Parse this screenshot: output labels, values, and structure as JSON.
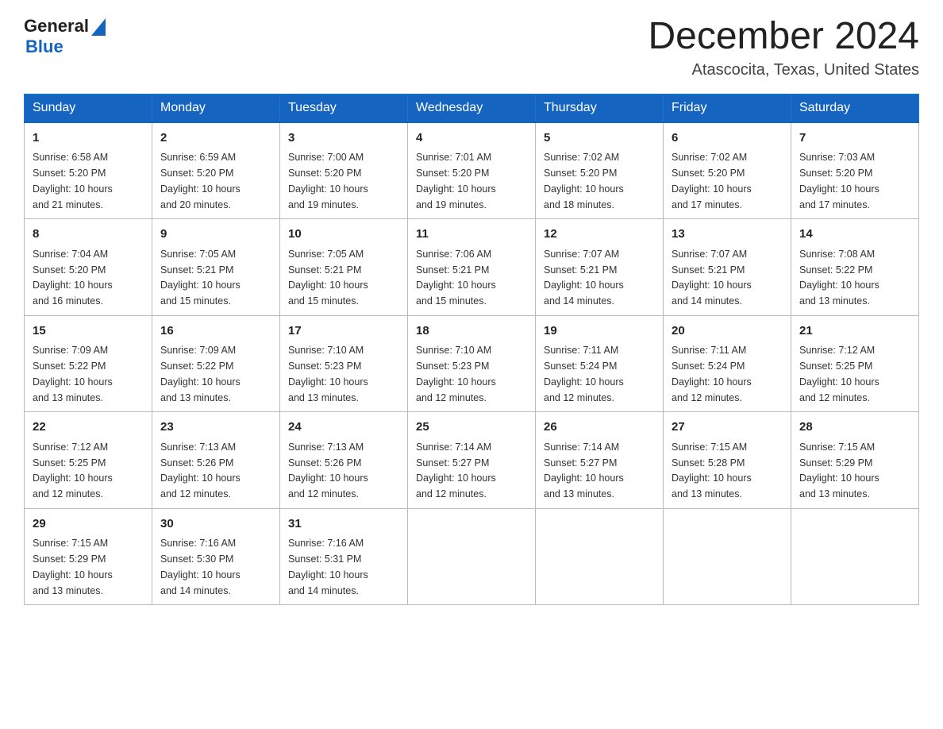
{
  "header": {
    "logo_text_general": "General",
    "logo_text_blue": "Blue",
    "month_title": "December 2024",
    "subtitle": "Atascocita, Texas, United States"
  },
  "days_of_week": [
    "Sunday",
    "Monday",
    "Tuesday",
    "Wednesday",
    "Thursday",
    "Friday",
    "Saturday"
  ],
  "weeks": [
    [
      {
        "day": "1",
        "sunrise": "6:58 AM",
        "sunset": "5:20 PM",
        "daylight": "10 hours and 21 minutes."
      },
      {
        "day": "2",
        "sunrise": "6:59 AM",
        "sunset": "5:20 PM",
        "daylight": "10 hours and 20 minutes."
      },
      {
        "day": "3",
        "sunrise": "7:00 AM",
        "sunset": "5:20 PM",
        "daylight": "10 hours and 19 minutes."
      },
      {
        "day": "4",
        "sunrise": "7:01 AM",
        "sunset": "5:20 PM",
        "daylight": "10 hours and 19 minutes."
      },
      {
        "day": "5",
        "sunrise": "7:02 AM",
        "sunset": "5:20 PM",
        "daylight": "10 hours and 18 minutes."
      },
      {
        "day": "6",
        "sunrise": "7:02 AM",
        "sunset": "5:20 PM",
        "daylight": "10 hours and 17 minutes."
      },
      {
        "day": "7",
        "sunrise": "7:03 AM",
        "sunset": "5:20 PM",
        "daylight": "10 hours and 17 minutes."
      }
    ],
    [
      {
        "day": "8",
        "sunrise": "7:04 AM",
        "sunset": "5:20 PM",
        "daylight": "10 hours and 16 minutes."
      },
      {
        "day": "9",
        "sunrise": "7:05 AM",
        "sunset": "5:21 PM",
        "daylight": "10 hours and 15 minutes."
      },
      {
        "day": "10",
        "sunrise": "7:05 AM",
        "sunset": "5:21 PM",
        "daylight": "10 hours and 15 minutes."
      },
      {
        "day": "11",
        "sunrise": "7:06 AM",
        "sunset": "5:21 PM",
        "daylight": "10 hours and 15 minutes."
      },
      {
        "day": "12",
        "sunrise": "7:07 AM",
        "sunset": "5:21 PM",
        "daylight": "10 hours and 14 minutes."
      },
      {
        "day": "13",
        "sunrise": "7:07 AM",
        "sunset": "5:21 PM",
        "daylight": "10 hours and 14 minutes."
      },
      {
        "day": "14",
        "sunrise": "7:08 AM",
        "sunset": "5:22 PM",
        "daylight": "10 hours and 13 minutes."
      }
    ],
    [
      {
        "day": "15",
        "sunrise": "7:09 AM",
        "sunset": "5:22 PM",
        "daylight": "10 hours and 13 minutes."
      },
      {
        "day": "16",
        "sunrise": "7:09 AM",
        "sunset": "5:22 PM",
        "daylight": "10 hours and 13 minutes."
      },
      {
        "day": "17",
        "sunrise": "7:10 AM",
        "sunset": "5:23 PM",
        "daylight": "10 hours and 13 minutes."
      },
      {
        "day": "18",
        "sunrise": "7:10 AM",
        "sunset": "5:23 PM",
        "daylight": "10 hours and 12 minutes."
      },
      {
        "day": "19",
        "sunrise": "7:11 AM",
        "sunset": "5:24 PM",
        "daylight": "10 hours and 12 minutes."
      },
      {
        "day": "20",
        "sunrise": "7:11 AM",
        "sunset": "5:24 PM",
        "daylight": "10 hours and 12 minutes."
      },
      {
        "day": "21",
        "sunrise": "7:12 AM",
        "sunset": "5:25 PM",
        "daylight": "10 hours and 12 minutes."
      }
    ],
    [
      {
        "day": "22",
        "sunrise": "7:12 AM",
        "sunset": "5:25 PM",
        "daylight": "10 hours and 12 minutes."
      },
      {
        "day": "23",
        "sunrise": "7:13 AM",
        "sunset": "5:26 PM",
        "daylight": "10 hours and 12 minutes."
      },
      {
        "day": "24",
        "sunrise": "7:13 AM",
        "sunset": "5:26 PM",
        "daylight": "10 hours and 12 minutes."
      },
      {
        "day": "25",
        "sunrise": "7:14 AM",
        "sunset": "5:27 PM",
        "daylight": "10 hours and 12 minutes."
      },
      {
        "day": "26",
        "sunrise": "7:14 AM",
        "sunset": "5:27 PM",
        "daylight": "10 hours and 13 minutes."
      },
      {
        "day": "27",
        "sunrise": "7:15 AM",
        "sunset": "5:28 PM",
        "daylight": "10 hours and 13 minutes."
      },
      {
        "day": "28",
        "sunrise": "7:15 AM",
        "sunset": "5:29 PM",
        "daylight": "10 hours and 13 minutes."
      }
    ],
    [
      {
        "day": "29",
        "sunrise": "7:15 AM",
        "sunset": "5:29 PM",
        "daylight": "10 hours and 13 minutes."
      },
      {
        "day": "30",
        "sunrise": "7:16 AM",
        "sunset": "5:30 PM",
        "daylight": "10 hours and 14 minutes."
      },
      {
        "day": "31",
        "sunrise": "7:16 AM",
        "sunset": "5:31 PM",
        "daylight": "10 hours and 14 minutes."
      },
      null,
      null,
      null,
      null
    ]
  ],
  "labels": {
    "sunrise": "Sunrise:",
    "sunset": "Sunset:",
    "daylight": "Daylight:"
  }
}
